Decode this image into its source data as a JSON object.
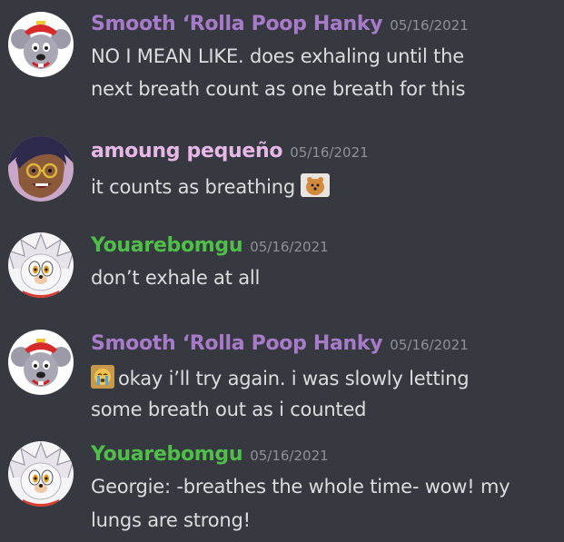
{
  "colors": {
    "background": "#36393f",
    "message_text": "#dcddde",
    "timestamp": "#8e9297",
    "user_smooth": "#a77bca",
    "user_amoung": "#e7b7e8",
    "user_youare": "#4fbf4a"
  },
  "messages": [
    {
      "username": "Smooth ‘Rolla Poop Hanky",
      "timestamp": "05/16/2021",
      "avatar_icon": "chuck-e-cheese-mouse-avatar",
      "lines": [
        "NO I MEAN LIKE. does exhaling until the",
        "next breath count as one breath for this"
      ]
    },
    {
      "username": "amoung pequeño",
      "timestamp": "05/16/2021",
      "avatar_icon": "cartoon-character-avatar",
      "lines": [
        "it counts as breathing"
      ],
      "emoji": "pomeranian-emoji"
    },
    {
      "username": "Youarebomgu",
      "timestamp": "05/16/2021",
      "avatar_icon": "hedgehog-character-avatar",
      "lines": [
        "don’t exhale at all"
      ]
    },
    {
      "username": "Smooth ‘Rolla Poop Hanky",
      "timestamp": "05/16/2021",
      "avatar_icon": "chuck-e-cheese-mouse-avatar",
      "emoji": "crying-emoji",
      "lines": [
        "okay i’ll try again. i was slowly letting",
        "some breath out as i counted"
      ]
    },
    {
      "username": "Youarebomgu",
      "timestamp": "05/16/2021",
      "avatar_icon": "hedgehog-character-avatar",
      "lines": [
        "Georgie: -breathes the whole time- wow! my",
        "lungs are strong!"
      ]
    }
  ]
}
